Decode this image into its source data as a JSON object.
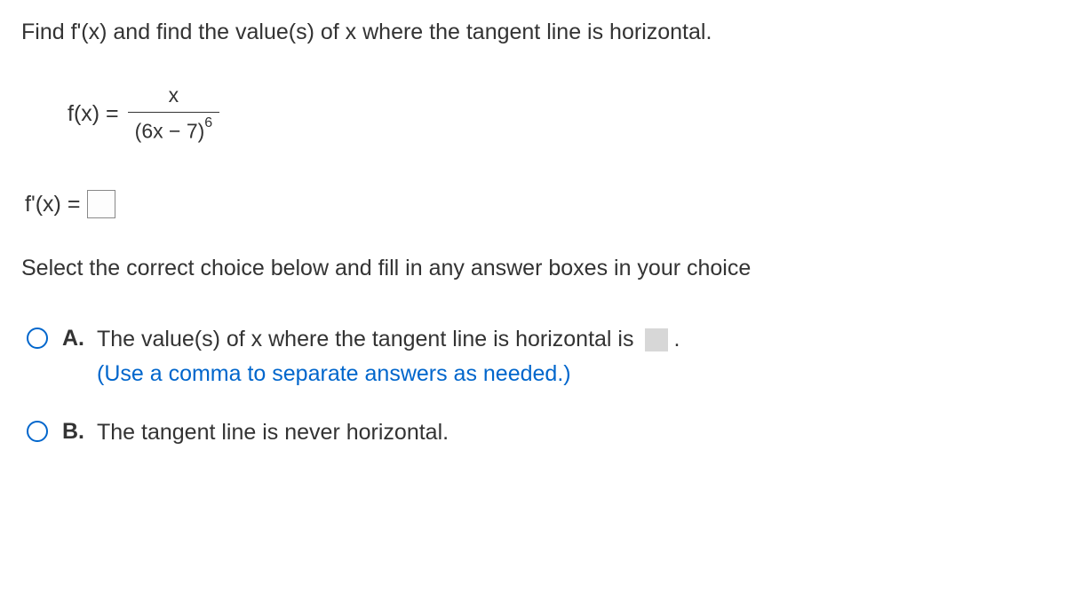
{
  "question": "Find f'(x) and find the value(s) of x where the tangent line is horizontal.",
  "function_label": "f(x) =",
  "fraction_numerator": "x",
  "fraction_denominator_base": "(6x − 7)",
  "fraction_denominator_exp": "6",
  "derivative_label": "f'(x) =",
  "select_instruction": "Select the correct choice below and fill in any answer boxes in your choice",
  "choices": {
    "a": {
      "letter": "A.",
      "text_before": "The value(s) of x where the tangent line is horizontal is",
      "text_after": ".",
      "hint": "(Use a comma to separate answers as needed.)"
    },
    "b": {
      "letter": "B.",
      "text": "The tangent line is never horizontal."
    }
  }
}
